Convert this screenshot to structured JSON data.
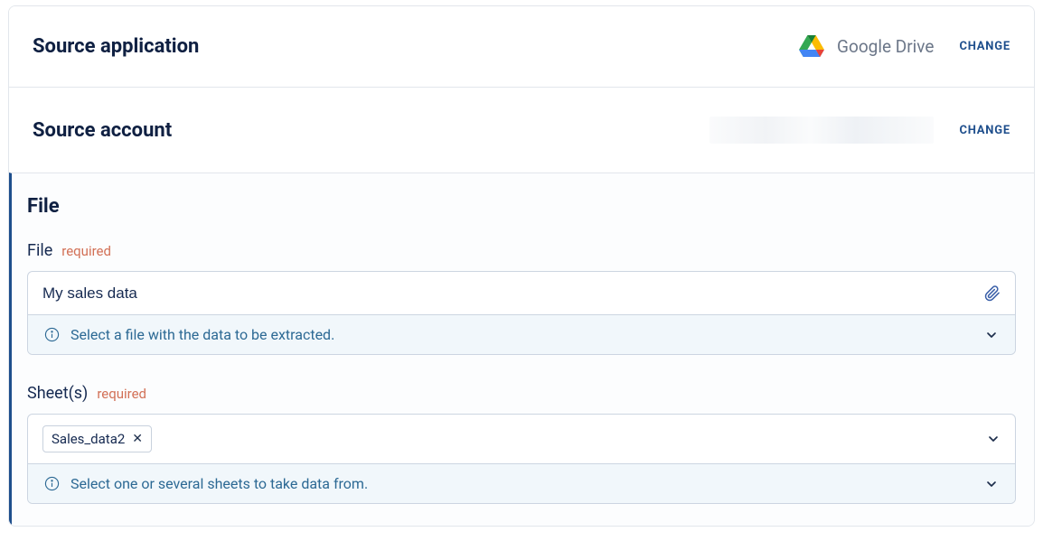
{
  "source_app": {
    "title": "Source application",
    "app_name": "Google Drive",
    "change": "CHANGE"
  },
  "source_account": {
    "title": "Source account",
    "change": "CHANGE"
  },
  "file_block": {
    "title": "File",
    "file_field": {
      "label": "File",
      "required": "required",
      "value": "My sales data",
      "hint": "Select a file with the data to be extracted."
    },
    "sheets_field": {
      "label": "Sheet(s)",
      "required": "required",
      "chip": "Sales_data2",
      "hint": "Select one or several sheets to take data from."
    }
  }
}
